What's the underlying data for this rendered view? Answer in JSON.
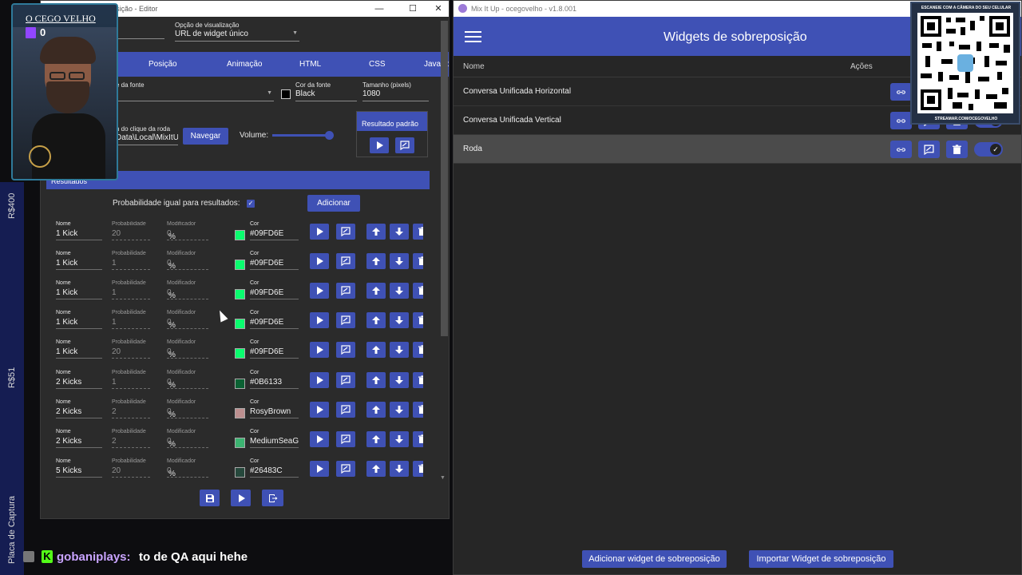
{
  "editor": {
    "window_title": "sição - Editor",
    "display_option": {
      "label": "Opção de visualização",
      "value": "URL de widget único"
    },
    "tabs": [
      "Posição",
      "Animação",
      "HTML",
      "CSS",
      "JavaScript"
    ],
    "font_family": {
      "label": "e da fonte",
      "value": "l"
    },
    "font_color": {
      "label": "Cor da fonte",
      "value": "Black"
    },
    "font_size": {
      "label": "Tamanho (pixels)",
      "value": "1080"
    },
    "wheel_sound": {
      "label": "n do clique da roda",
      "value": "Data\\Local\\MixItU"
    },
    "browse_button": "Navegar",
    "volume_label": "Volume:",
    "volume_level": 0.95,
    "default_result_label": "Resultado padrão",
    "results_header": "Resultados",
    "equal_probability_label": "Probabilidade igual para resultados:",
    "add_button": "Adicionar",
    "column_labels": {
      "name": "Nome",
      "probability": "Probabilidade",
      "modifier": "Modificador",
      "color": "Cor"
    },
    "rows": [
      {
        "name": "1 Kick",
        "probability": "20",
        "modifier": "0",
        "color_name": "#09FD6E",
        "swatch": "#09FD6E"
      },
      {
        "name": "1 Kick",
        "probability": "1",
        "modifier": "0",
        "color_name": "#09FD6E",
        "swatch": "#09FD6E"
      },
      {
        "name": "1 Kick",
        "probability": "1",
        "modifier": "0",
        "color_name": "#09FD6E",
        "swatch": "#09FD6E"
      },
      {
        "name": "1 Kick",
        "probability": "1",
        "modifier": "0",
        "color_name": "#09FD6E",
        "swatch": "#09FD6E"
      },
      {
        "name": "1 Kick",
        "probability": "20",
        "modifier": "0",
        "color_name": "#09FD6E",
        "swatch": "#09FD6E"
      },
      {
        "name": "2 Kicks",
        "probability": "1",
        "modifier": "0",
        "color_name": "#0B6133",
        "swatch": "#0B6133"
      },
      {
        "name": "2 Kicks",
        "probability": "2",
        "modifier": "0",
        "color_name": "RosyBrown",
        "swatch": "#BC8F8F"
      },
      {
        "name": "2 Kicks",
        "probability": "2",
        "modifier": "0",
        "color_name": "MediumSeaG",
        "swatch": "#3CB371"
      },
      {
        "name": "5 Kicks",
        "probability": "20",
        "modifier": "0",
        "color_name": "#26483C",
        "swatch": "#26483C"
      }
    ],
    "percent_sign": "%"
  },
  "mixitup": {
    "window_title": "Mix It Up - ocegovelho - v1.8.001",
    "header_title": "Widgets de sobreposição",
    "columns": {
      "name": "Nome",
      "actions": "Ações"
    },
    "widgets": [
      {
        "name": "Conversa Unificada Horizontal"
      },
      {
        "name": "Conversa Unificada Vertical"
      },
      {
        "name": "Roda"
      }
    ],
    "add_widget_button": "Adicionar widget de sobreposição",
    "import_widget_button": "Importar Widget de sobreposição"
  },
  "overlay": {
    "streamer_name": "O CEGO VELHO",
    "twitch_count": "0",
    "side_labels": [
      "R$400",
      "R$51",
      "Placa de Captura"
    ],
    "qr_caption_top": "ESCANEIE COM A CÂMERA DO SEU CELULAR",
    "qr_caption_bottom": "STREAMAR.COM/OCEGOVELHO",
    "chat_user": "gobaniplays:",
    "chat_message": "to de QA aqui hehe"
  },
  "colors": {
    "accent": "#3f51b5",
    "window_bg": "#2b2b2b",
    "twitch": "#9146ff",
    "kick": "#53fc18"
  }
}
